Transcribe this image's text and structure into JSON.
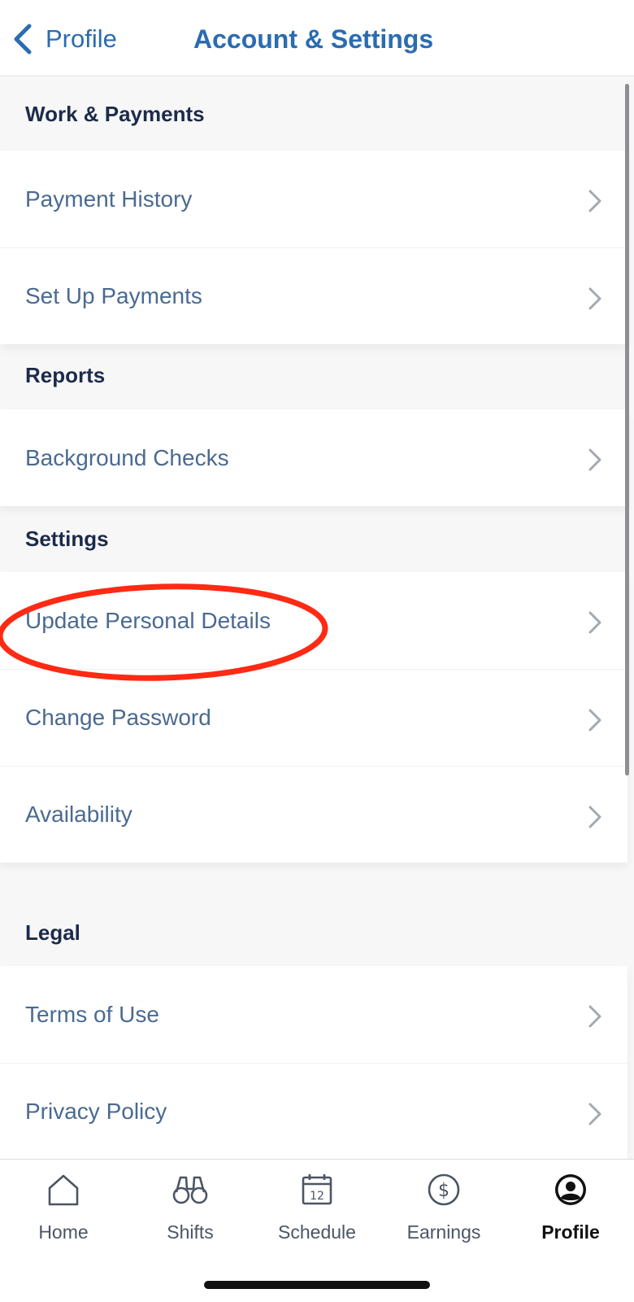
{
  "header": {
    "back_label": "Profile",
    "title": "Account & Settings"
  },
  "sections": [
    {
      "header": "Work & Payments",
      "items": [
        {
          "label": "Payment History"
        },
        {
          "label": "Set Up Payments"
        }
      ]
    },
    {
      "header": "Reports",
      "items": [
        {
          "label": "Background Checks"
        }
      ]
    },
    {
      "header": "Settings",
      "items": [
        {
          "label": "Update Personal Details"
        },
        {
          "label": "Change Password"
        },
        {
          "label": "Availability"
        }
      ]
    },
    {
      "header": "Legal",
      "items": [
        {
          "label": "Terms of Use"
        },
        {
          "label": "Privacy Policy"
        }
      ]
    }
  ],
  "annotation": {
    "shape": "ellipse",
    "color": "#ff2a14",
    "highlights": "Update Personal Details"
  },
  "tabs": [
    {
      "label": "Home",
      "icon": "home-icon"
    },
    {
      "label": "Shifts",
      "icon": "binoculars-icon"
    },
    {
      "label": "Schedule",
      "icon": "calendar-icon"
    },
    {
      "label": "Earnings",
      "icon": "dollar-circle-icon"
    },
    {
      "label": "Profile",
      "icon": "profile-icon",
      "active": true
    }
  ],
  "colors": {
    "accent": "#2b6cb0",
    "row_text": "#4a6a91",
    "section_text": "#1c2b4a",
    "background": "#f7f7f8"
  }
}
